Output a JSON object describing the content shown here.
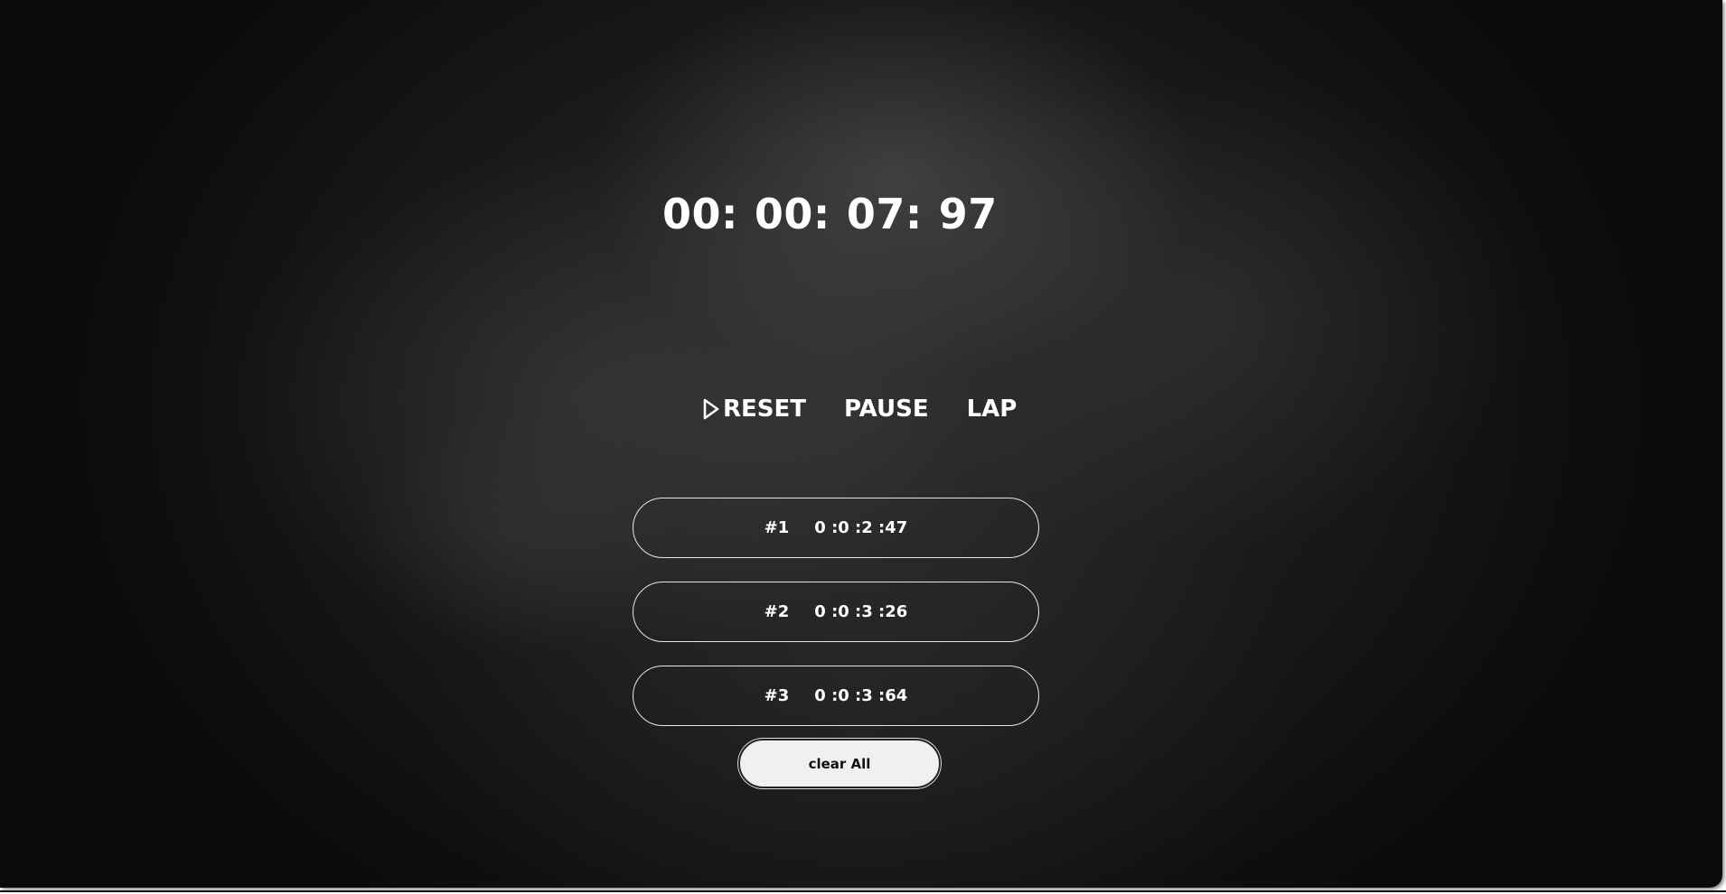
{
  "timer": {
    "hours": "00:",
    "minutes": "00:",
    "seconds": "07:",
    "centiseconds": "97"
  },
  "controls": {
    "reset_label": "RESET",
    "reset_icon": "play-outline-icon",
    "pause_label": "PAUSE",
    "lap_label": "LAP"
  },
  "laps": [
    {
      "number": "#1",
      "time": "0 :0 :2 :47"
    },
    {
      "number": "#2",
      "time": "0 :0 :3 :26"
    },
    {
      "number": "#3",
      "time": "0 :0 :3 :64"
    }
  ],
  "clear_all_label": "clear All",
  "colors": {
    "text": "#ffffff",
    "button_bg": "#f0f0f0",
    "button_text": "#111111",
    "lap_border": "#e6e6e6"
  }
}
